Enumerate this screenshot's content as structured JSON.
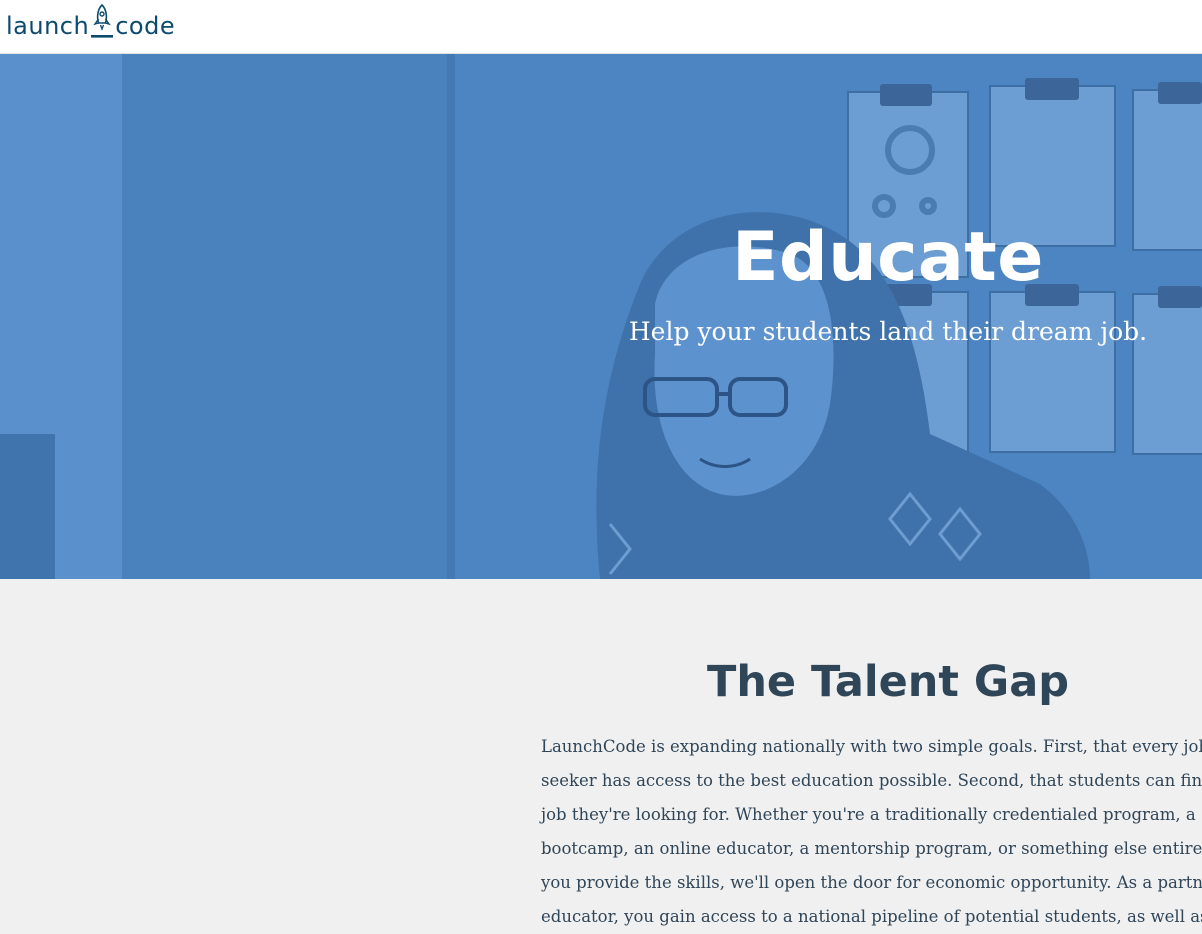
{
  "navbar": {
    "logo_left": "launch",
    "logo_right": "code",
    "logo_icon": "rocket-icon",
    "brand_color": "#0c4a6e"
  },
  "hero": {
    "title": "Educate",
    "subtitle": "Help your students land their dream job.",
    "overlay_color": "#4c85c2"
  },
  "talent_gap": {
    "title": "The Talent Gap",
    "lines": [
      "LaunchCode is expanding nationally with two simple goals. First, that every job",
      "seeker has access to the best education possible. Second, that students can find t",
      "job they're looking for. Whether you're a traditionally credentialed program, a",
      "bootcamp, an online educator, a mentorship program, or something else entirely",
      "you provide the skills, we'll open the door for economic opportunity. As a partne",
      "educator, you gain access to a national pipeline of potential students, as well as"
    ],
    "text_color": "#2f4558"
  }
}
